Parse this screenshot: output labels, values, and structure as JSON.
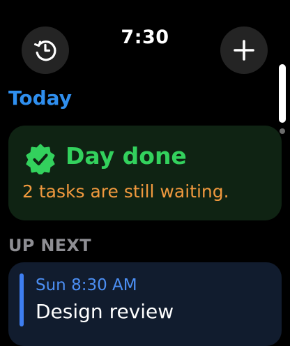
{
  "status_bar": {
    "time": "7:30"
  },
  "toolbar": {
    "history_icon": "clock-history-icon",
    "add_icon": "plus-icon"
  },
  "today": {
    "header": "Today",
    "card": {
      "icon": "checkmark-seal-icon",
      "title": "Day done",
      "subtitle": "2 tasks are still waiting."
    }
  },
  "up_next": {
    "header": "UP NEXT",
    "events": [
      {
        "time": "Sun 8:30 AM",
        "title": "Design review"
      }
    ]
  },
  "colors": {
    "accent_blue": "#2f8fef",
    "done_green": "#33d15d",
    "waiting_orange": "#f0993e",
    "event_blue": "#4c8ff4",
    "done_card_bg": "#0f2313",
    "event_card_bg": "#111c2e",
    "button_bg": "#242424"
  }
}
